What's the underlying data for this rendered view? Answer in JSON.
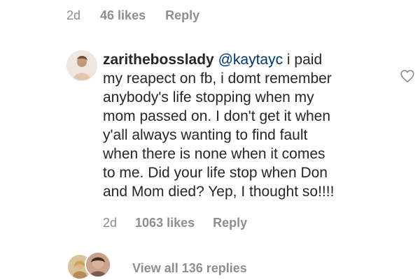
{
  "previous_comment": {
    "age": "2d",
    "likes": "46 likes",
    "reply_label": "Reply"
  },
  "comment": {
    "username": "zarithebosslady",
    "mention": "@kaytayc",
    "text": " i paid\nmy reapect on fb, i domt remember\nanybody's life stopping when my\nmom passed on. I don't get it when\ny'all always wanting to find fault\nwhen there is none when it comes\nto me. Did your life stop when Don\nand Mom died? Yep, I thought so!!!!",
    "age": "2d",
    "likes": "1063 likes",
    "reply_label": "Reply"
  },
  "replies": {
    "view_label": "View all 136 replies"
  },
  "icons": {
    "like": "heart-outline-icon"
  },
  "colors": {
    "text": "#262626",
    "muted": "#8e8e8e",
    "mention": "#003569"
  }
}
